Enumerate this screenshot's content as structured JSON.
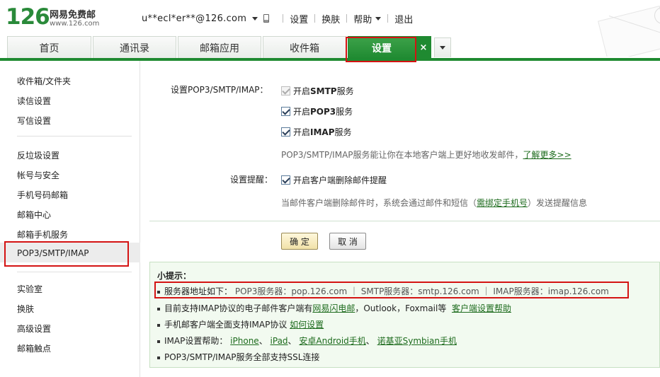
{
  "header": {
    "logo_number": "126",
    "logo_name": "网易免费邮",
    "logo_url": "www.126.com",
    "account": "u**ecl*er**@126.com",
    "links": [
      "设置",
      "换肤",
      "帮助",
      "退出"
    ]
  },
  "tabs": [
    {
      "label": "首页"
    },
    {
      "label": "通讯录"
    },
    {
      "label": "邮箱应用"
    },
    {
      "label": "收件箱"
    },
    {
      "label": "设置",
      "active": true
    }
  ],
  "tab_close": "×",
  "sidebar": {
    "group1": [
      "收件箱/文件夹",
      "读信设置",
      "写信设置"
    ],
    "group2": [
      "反垃圾设置",
      "帐号与安全",
      "手机号码邮箱",
      "邮箱中心",
      "邮箱手机服务",
      "POP3/SMTP/IMAP"
    ],
    "group3": [
      "实验室",
      "换肤",
      "高级设置",
      "邮箱触点"
    ],
    "selected": "POP3/SMTP/IMAP"
  },
  "settings": {
    "pop_label": "设置POP3/SMTP/IMAP：",
    "smtp_prefix": "开启",
    "smtp_bold": "SMTP",
    "smtp_suffix": "服务",
    "pop3_prefix": "开启",
    "pop3_bold": "POP3",
    "pop3_suffix": "服务",
    "imap_prefix": "开启",
    "imap_bold": "IMAP",
    "imap_suffix": "服务",
    "pop_hint": "POP3/SMTP/IMAP服务能让你在本地客户端上更好地收发邮件，",
    "pop_hint_link": "了解更多>>",
    "remind_label": "设置提醒：",
    "remind_checkbox": "开启客户端删除邮件提醒",
    "remind_hint_pre": "当邮件客户端删除邮件时，系统会通过邮件和短信（",
    "remind_hint_link": "需绑定手机号",
    "remind_hint_post": "）发送提醒信息",
    "ok_button": "确 定",
    "cancel_button": "取 消"
  },
  "tips": {
    "title": "小提示：",
    "server_label": "服务器地址如下：",
    "server_values": "POP3服务器：pop.126.com ｜ SMTP服务器：smtp.126.com ｜ IMAP服务器：imap.126.com",
    "tip2_pre": "目前支持IMAP协议的电子邮件客户端有",
    "tip2_link1": "网易闪电邮",
    "tip2_mid": "，Outlook，Foxmail等",
    "tip2_link2": "客户端设置帮助",
    "tip3_pre": "手机邮客户端全面支持IMAP协议",
    "tip3_link": "如何设置",
    "tip4_pre": "IMAP设置帮助：",
    "tip4_link1": "iPhone",
    "tip4_link2": "iPad",
    "tip4_link3": "安卓Android手机",
    "tip4_link4": "诺基亚Symbian手机",
    "tip4_sep": "、",
    "tip5": "POP3/SMTP/IMAP服务全部支持SSL连接"
  },
  "colors": {
    "brand_green": "#1f8a31",
    "highlight_red": "#d41313",
    "link_green": "#1d6b1d"
  }
}
